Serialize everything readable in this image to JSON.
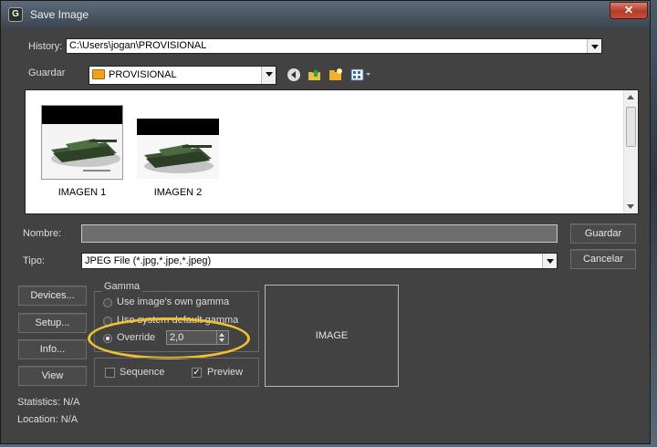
{
  "window": {
    "title": "Save Image",
    "close_glyph": "✕",
    "app_icon_glyph": "G"
  },
  "history": {
    "label": "History:",
    "value": "C:\\Users\\jogan\\PROVISIONAL"
  },
  "save_in": {
    "label": "Guardar",
    "value": "PROVISIONAL"
  },
  "toolbar": {
    "icons": [
      "back-icon",
      "up-folder-icon",
      "new-folder-icon",
      "view-menu-icon"
    ]
  },
  "files": [
    {
      "name": "IMAGEN 1"
    },
    {
      "name": "IMAGEN 2"
    }
  ],
  "filename": {
    "label": "Nombre:",
    "value": ""
  },
  "filetype": {
    "label": "Tipo:",
    "value": "JPEG File (*.jpg,*.jpe,*.jpeg)"
  },
  "buttons": {
    "save": "Guardar",
    "cancel": "Cancelar",
    "devices": "Devices...",
    "setup": "Setup...",
    "info": "Info...",
    "view": "View"
  },
  "gamma": {
    "title": "Gamma",
    "own": "Use image's own gamma",
    "system": "Use system default gamma",
    "override": "Override",
    "override_value": "2,0",
    "selected": "override"
  },
  "options": {
    "sequence": "Sequence",
    "sequence_checked": false,
    "preview": "Preview",
    "preview_checked": true
  },
  "preview_area": {
    "text": "IMAGE"
  },
  "statistics": {
    "label": "Statistics:",
    "value": "N/A"
  },
  "location": {
    "label": "Location:",
    "value": "N/A"
  },
  "colors": {
    "highlight_ellipse": "#f0c030",
    "folder": "#f0a020",
    "close_button": "#c8503a"
  }
}
